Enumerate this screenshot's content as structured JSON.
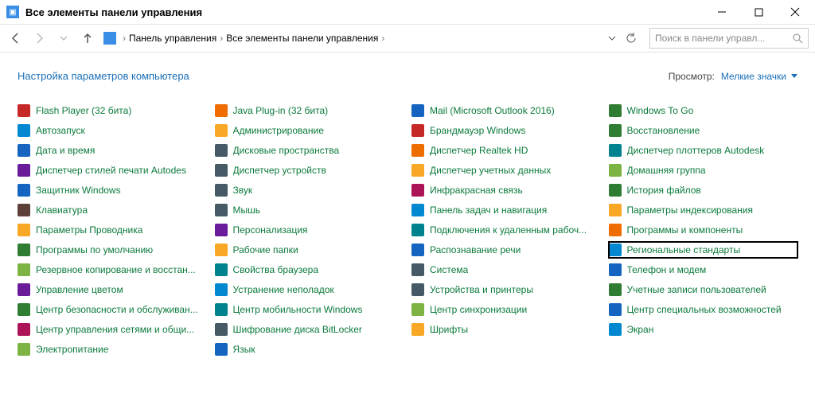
{
  "window": {
    "title": "Все элементы панели управления"
  },
  "breadcrumb": {
    "seg1": "Панель управления",
    "seg2": "Все элементы панели управления"
  },
  "search": {
    "placeholder": "Поиск в панели управл..."
  },
  "subheader": {
    "title": "Настройка параметров компьютера",
    "view_label": "Просмотр:",
    "view_value": "Мелкие значки"
  },
  "items": [
    {
      "label": "Flash Player (32 бита)",
      "c": "c1"
    },
    {
      "label": "Java Plug-in (32 бита)",
      "c": "c7"
    },
    {
      "label": "Mail (Microsoft Outlook 2016)",
      "c": "c2"
    },
    {
      "label": "Windows To Go",
      "c": "c4"
    },
    {
      "label": "Автозапуск",
      "c": "c11"
    },
    {
      "label": "Администрирование",
      "c": "c3"
    },
    {
      "label": "Брандмауэр Windows",
      "c": "c1"
    },
    {
      "label": "Восстановление",
      "c": "c4"
    },
    {
      "label": "Дата и время",
      "c": "c2"
    },
    {
      "label": "Дисковые пространства",
      "c": "c8"
    },
    {
      "label": "Диспетчер Realtek HD",
      "c": "c7"
    },
    {
      "label": "Диспетчер плоттеров Autodesk",
      "c": "c6"
    },
    {
      "label": "Диспетчер стилей печати Autodes",
      "c": "c5"
    },
    {
      "label": "Диспетчер устройств",
      "c": "c8"
    },
    {
      "label": "Диспетчер учетных данных",
      "c": "c3"
    },
    {
      "label": "Домашняя группа",
      "c": "c12"
    },
    {
      "label": "Защитник Windows",
      "c": "c2"
    },
    {
      "label": "Звук",
      "c": "c8"
    },
    {
      "label": "Инфракрасная связь",
      "c": "c9"
    },
    {
      "label": "История файлов",
      "c": "c4"
    },
    {
      "label": "Клавиатура",
      "c": "c10"
    },
    {
      "label": "Мышь",
      "c": "c8"
    },
    {
      "label": "Панель задач и навигация",
      "c": "c11"
    },
    {
      "label": "Параметры индексирования",
      "c": "c3"
    },
    {
      "label": "Параметры Проводника",
      "c": "c3"
    },
    {
      "label": "Персонализация",
      "c": "c5"
    },
    {
      "label": "Подключения к удаленным рабоч...",
      "c": "c6"
    },
    {
      "label": "Программы и компоненты",
      "c": "c7"
    },
    {
      "label": "Программы по умолчанию",
      "c": "c4"
    },
    {
      "label": "Рабочие папки",
      "c": "c3"
    },
    {
      "label": "Распознавание речи",
      "c": "c2"
    },
    {
      "label": "Региональные стандарты",
      "c": "c11",
      "hilite": true
    },
    {
      "label": "Резервное копирование и восстан...",
      "c": "c12"
    },
    {
      "label": "Свойства браузера",
      "c": "c6"
    },
    {
      "label": "Система",
      "c": "c8"
    },
    {
      "label": "Телефон и модем",
      "c": "c2"
    },
    {
      "label": "Управление цветом",
      "c": "c5"
    },
    {
      "label": "Устранение неполадок",
      "c": "c11"
    },
    {
      "label": "Устройства и принтеры",
      "c": "c8"
    },
    {
      "label": "Учетные записи пользователей",
      "c": "c4"
    },
    {
      "label": "Центр безопасности и обслуживан...",
      "c": "c4"
    },
    {
      "label": "Центр мобильности Windows",
      "c": "c6"
    },
    {
      "label": "Центр синхронизации",
      "c": "c12"
    },
    {
      "label": "Центр специальных возможностей",
      "c": "c2"
    },
    {
      "label": "Центр управления сетями и общи...",
      "c": "c9"
    },
    {
      "label": "Шифрование диска BitLocker",
      "c": "c8"
    },
    {
      "label": "Шрифты",
      "c": "c3"
    },
    {
      "label": "Экран",
      "c": "c11"
    },
    {
      "label": "Электропитание",
      "c": "c12"
    },
    {
      "label": "Язык",
      "c": "c2"
    }
  ]
}
